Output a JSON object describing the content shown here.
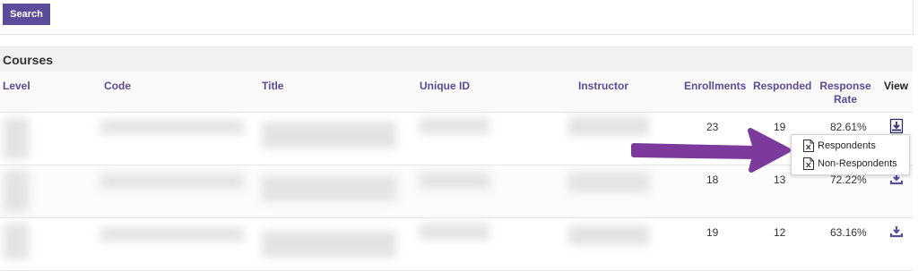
{
  "search": {
    "button_label": "Search"
  },
  "section": {
    "title": "Courses"
  },
  "table": {
    "headers": {
      "level": "Level",
      "code": "Code",
      "title": "Title",
      "unique_id": "Unique ID",
      "instructor": "Instructor",
      "enrollments": "Enrollments",
      "responded": "Responded",
      "response_rate_line1": "Response",
      "response_rate_line2": "Rate",
      "view": "View"
    },
    "rows": [
      {
        "enrollments": "23",
        "responded": "19",
        "response_rate": "82.61%"
      },
      {
        "enrollments": "18",
        "responded": "13",
        "response_rate": "72.22%"
      },
      {
        "enrollments": "19",
        "responded": "12",
        "response_rate": "63.16%"
      }
    ]
  },
  "download_menu": {
    "items": [
      {
        "label": "Respondents",
        "icon": "excel-file-icon"
      },
      {
        "label": "Non-Respondents",
        "icon": "excel-file-icon"
      }
    ]
  },
  "colors": {
    "accent": "#5c4a9a",
    "arrow": "#7b3a9c"
  }
}
